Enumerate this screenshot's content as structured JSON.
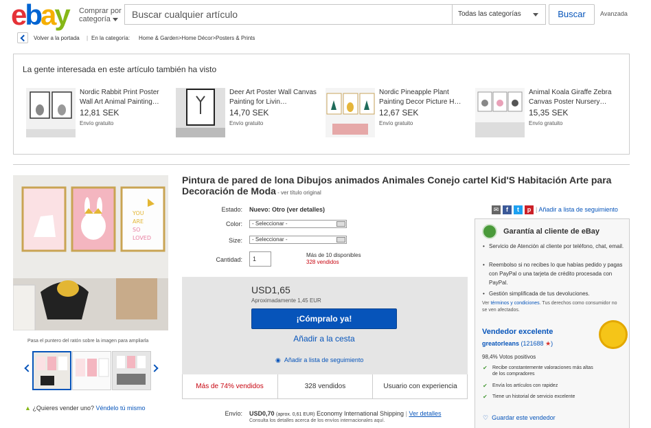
{
  "header": {
    "logo": [
      "e",
      "b",
      "a",
      "y"
    ],
    "shop_by_category": [
      "Comprar por",
      "categoría"
    ],
    "search_placeholder": "Buscar cualquier artículo",
    "category_select": "Todas las categorías",
    "search_button": "Buscar",
    "advanced": "Avanzada"
  },
  "breadcrumb": {
    "back": "Volver a la portada",
    "in_category": "En la categoría:",
    "path": "Home & Garden>Home Décor>Posters & Prints"
  },
  "also_viewed": {
    "title": "La gente interesada en este artículo también ha visto",
    "items": [
      {
        "title": "Nordic Rabbit Print Poster Wall Art Animal Painting…",
        "price": "12,81 SEK",
        "shipping": "Envío gratuito"
      },
      {
        "title": "Deer Art Poster Wall Canvas Painting for Livin…",
        "price": "14,70 SEK",
        "shipping": "Envío gratuito"
      },
      {
        "title": "Nordic Pineapple Plant Painting Decor Picture H…",
        "price": "12,67 SEK",
        "shipping": "Envío gratuito"
      },
      {
        "title": "Animal Koala Giraffe Zebra Canvas Poster Nursery…",
        "price": "15,35 SEK",
        "shipping": "Envío gratuito"
      }
    ]
  },
  "product": {
    "title": "Pintura de pared de lona Dibujos animados Animales Conejo cartel Kid'S Habitación Arte para Decoración de Moda",
    "title_sep": " - ",
    "original_title": "ver título original",
    "image_hint": "Pasa el puntero del ratón sobre la imagen para ampliarla",
    "sell_question": "¿Quieres vender uno?",
    "sell_link": "Véndelo tú mismo",
    "image_text": [
      "YOU",
      "ARE",
      "SO",
      "LOVED"
    ]
  },
  "share": {
    "watchlist": "Añadir a lista de seguimiento"
  },
  "details": {
    "condition_label": "Estado:",
    "condition_value": "Nuevo: Otro (ver detalles)",
    "color_label": "Color:",
    "color_value": "- Seleccionar -",
    "size_label": "Size:",
    "size_value": "- Seleccionar -",
    "quantity_label": "Cantidad:",
    "quantity_value": "1",
    "available": "Más de 10 disponibles",
    "sold": "328 vendidos"
  },
  "buy": {
    "price": "USD1,65",
    "approx": "Aproximadamente 1,45 EUR",
    "buy_now": "¡Cómpralo ya!",
    "add_to_cart": "Añadir a la cesta",
    "add_to_watch": "Añadir a lista de seguimiento"
  },
  "stats": {
    "percent_sold": "Más de 74% vendidos",
    "sold": "328 vendidos",
    "experience": "Usuario con experiencia"
  },
  "shipping": {
    "label": "Envío:",
    "cost": "USD0,70",
    "cost_approx": "(aprox. 0,61 EUR)",
    "method": "Economy International Shipping",
    "details": "Ver detalles",
    "sub": "Consulta los detalles acerca de los envíos internacionales aquí."
  },
  "guarantee": {
    "title": "Garantía al cliente de eBay",
    "items": [
      "Servicio de Atención al cliente por teléfono, chat, email.",
      "Reembolso si no recibes lo que habías pedido y pagas con PayPal o una tarjeta de crédito procesada con PayPal.",
      "Gestión simplificada de tus devoluciones."
    ],
    "terms_prefix": "Ver",
    "terms_link": "términos y condiciones",
    "terms_suffix": ". Tus derechos como consumidor no se ven afectados."
  },
  "seller": {
    "badge": "Vendedor excelente",
    "name": "greatorleans",
    "feedback": "121688",
    "positive": "98,4% Votos positivos",
    "checks": [
      "Recibe constantemente valoraciones más altas de los compradores",
      "Envía los artículos con rapidez",
      "Tiene un historial de servicio excelente"
    ],
    "save": "Guardar este vendedor"
  },
  "colors": {
    "ebay_blue": "#0654ba",
    "sold_red": "#c7040f",
    "guarantee_green": "#4a9a3a"
  }
}
